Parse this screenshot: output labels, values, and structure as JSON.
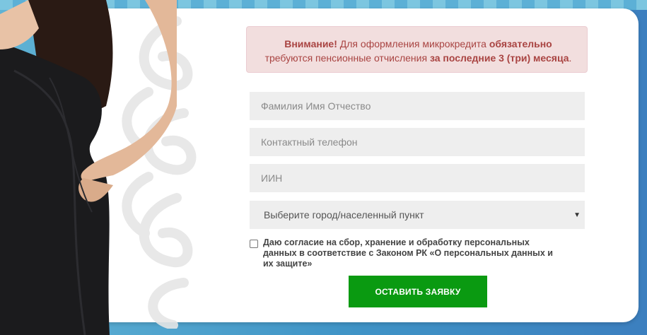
{
  "alert": {
    "attention": "Внимание!",
    "text1": " Для оформления микрокредита ",
    "mandatory": "обязательно",
    "text2": "требуются пенсионные отчисления ",
    "period": "за последние 3 (три) месяца",
    "dot": "."
  },
  "form": {
    "fullname_placeholder": "Фамилия Имя Отчество",
    "phone_placeholder": "Контактный телефон",
    "iin_placeholder": "ИИН",
    "city_selected": "Выберите город/населенный пункт",
    "consent_text": "Даю согласие на сбор, хранение и обработку персональных данных в соответствие с Законом РК «О персональных данных и их защите»",
    "submit_label": "ОСТАВИТЬ ЗАЯВКУ"
  },
  "colors": {
    "submit": "#0a9a11",
    "alert_bg": "#f2dede",
    "alert_text": "#a94442",
    "background": "#3f93c6"
  }
}
